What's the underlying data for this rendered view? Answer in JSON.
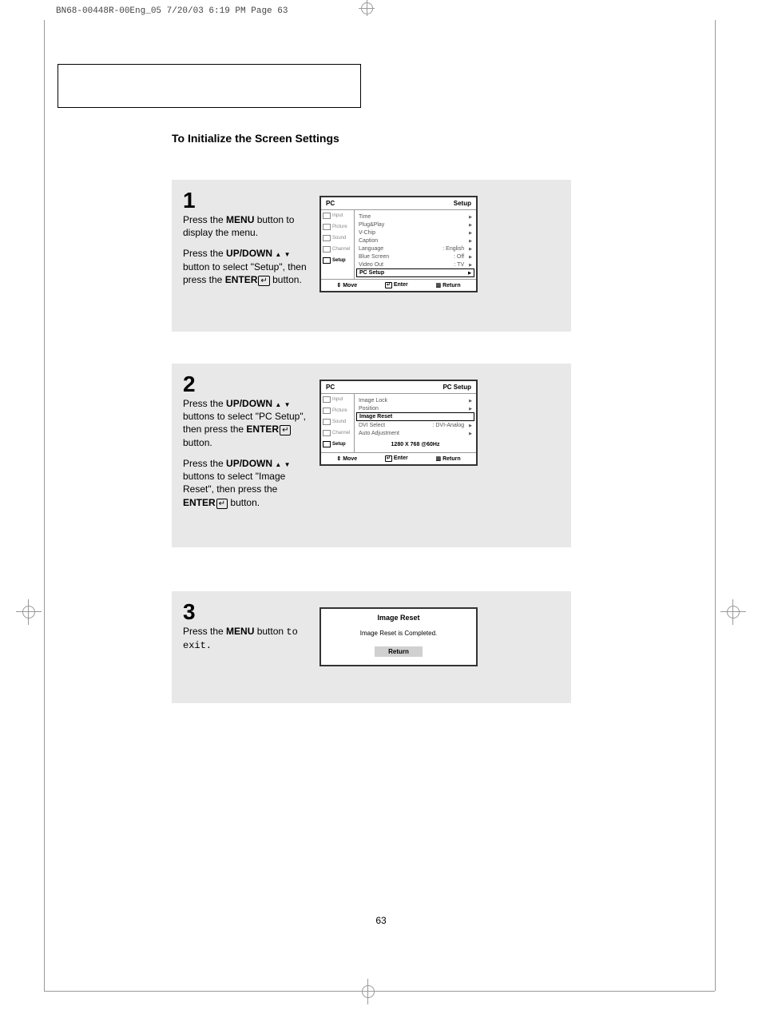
{
  "print_header": "BN68-00448R-00Eng_05  7/20/03 6:19 PM  Page 63",
  "section_title": "To Initialize the Screen Settings",
  "steps": {
    "s1": {
      "num": "1",
      "p1a": "Press the ",
      "p1b": "MENU",
      "p1c": " button to display the menu.",
      "p2a": "Press the ",
      "p2b": "UP/DOWN",
      "p2c": " button to select \"Setup\", then press the ",
      "p2d": "ENTER",
      "p2e": " button."
    },
    "s2": {
      "num": "2",
      "p1a": "Press the ",
      "p1b": "UP/DOWN",
      "p1c": " buttons to select \"PC Setup\", then press the ",
      "p1d": "ENTER",
      "p1e": " button.",
      "p2a": "Press the ",
      "p2b": "UP/DOWN",
      "p2c": " buttons to select \"Image Reset\", then press the ",
      "p2d": "ENTER",
      "p2e": "  button."
    },
    "s3": {
      "num": "3",
      "p1a": "Press the ",
      "p1b": "MENU",
      "p1c": " button ",
      "p1d": "to exit."
    }
  },
  "osd1": {
    "hl": "PC",
    "hr": "Setup",
    "side": [
      "Input",
      "Picture",
      "Sound",
      "Channel",
      "Setup"
    ],
    "rows": [
      {
        "l": "Time",
        "v": "",
        "a": true
      },
      {
        "l": "Plug&Play",
        "v": "",
        "a": true
      },
      {
        "l": "V-Chip",
        "v": "",
        "a": true
      },
      {
        "l": "Caption",
        "v": "",
        "a": true
      },
      {
        "l": "Language",
        "v": ": English",
        "a": true
      },
      {
        "l": "Blue Screen",
        "v": ": Off",
        "a": true
      },
      {
        "l": "Video Out",
        "v": ": TV",
        "a": true
      },
      {
        "l": "PC Setup",
        "v": "",
        "a": true,
        "sel": true
      }
    ],
    "foot": {
      "m": "Move",
      "e": "Enter",
      "r": "Return"
    }
  },
  "osd2": {
    "hl": "PC",
    "hr": "PC Setup",
    "side": [
      "Input",
      "Picture",
      "Sound",
      "Channel",
      "Setup"
    ],
    "rows": [
      {
        "l": "Image Lock",
        "v": "",
        "a": true
      },
      {
        "l": "Position",
        "v": "",
        "a": true
      },
      {
        "l": "Image Reset",
        "v": "",
        "a": false,
        "sel": true
      },
      {
        "l": "DVI Select",
        "v": ": DVI-Analog",
        "a": true
      },
      {
        "l": "Auto Adjustment",
        "v": "",
        "a": true
      }
    ],
    "res": "1280 X 768 @60Hz",
    "foot": {
      "m": "Move",
      "e": "Enter",
      "r": "Return"
    }
  },
  "osd3": {
    "title": "Image Reset",
    "msg": "Image Reset is Completed.",
    "btn": "Return"
  },
  "page_num": "63"
}
